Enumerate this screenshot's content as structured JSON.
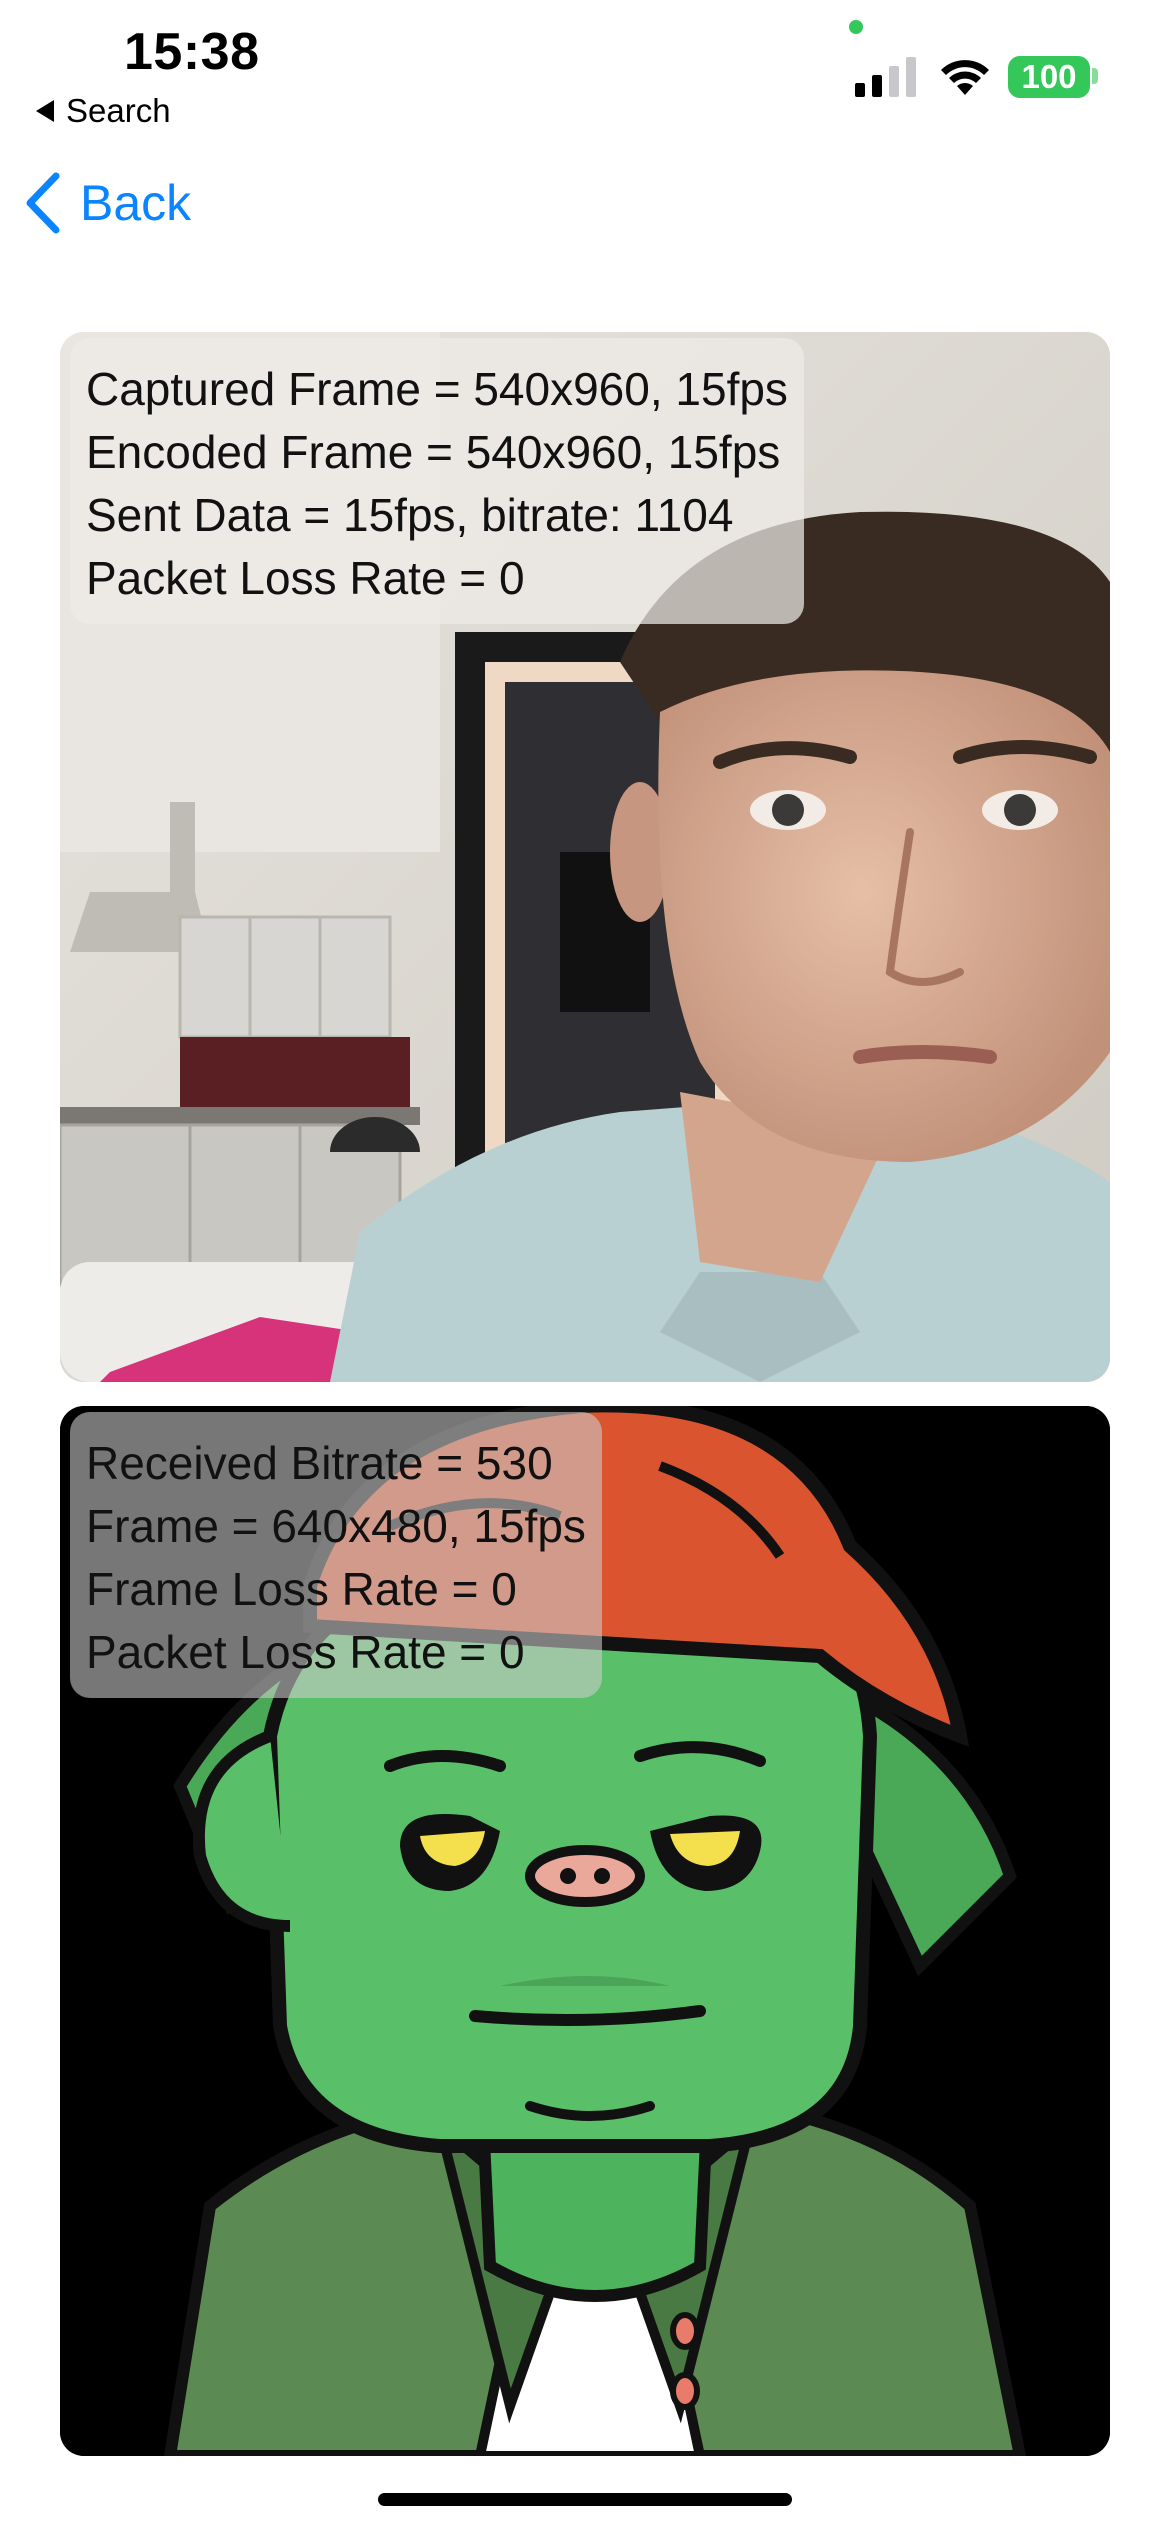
{
  "status_bar": {
    "time": "15:38",
    "back_to_app": "Search",
    "battery": "100",
    "icons": [
      "signal-icon",
      "wifi-icon",
      "battery-icon"
    ],
    "accent_green": "#34c759"
  },
  "nav": {
    "back_label": "Back",
    "accent": "#0a84ff"
  },
  "local_video": {
    "stats": [
      "Captured Frame = 540x960, 15fps",
      "Encoded Frame = 540x960, 15fps",
      "Sent Data = 15fps, bitrate: 1104",
      "Packet Loss Rate = 0"
    ]
  },
  "remote_video": {
    "stats": [
      "Received Bitrate = 530",
      "Frame = 640x480, 15fps",
      "Frame Loss Rate = 0",
      "Packet Loss Rate = 0"
    ]
  }
}
